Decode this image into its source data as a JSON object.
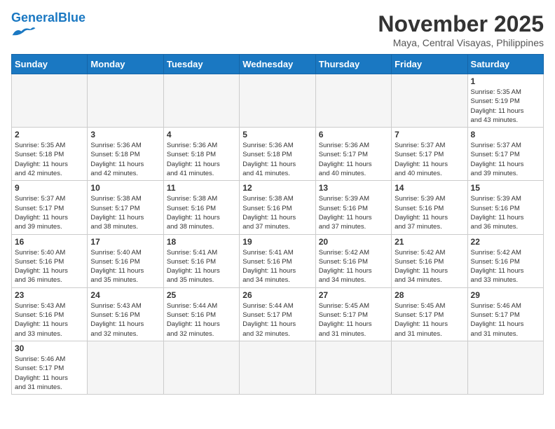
{
  "header": {
    "logo_general": "General",
    "logo_blue": "Blue",
    "month_title": "November 2025",
    "location": "Maya, Central Visayas, Philippines"
  },
  "weekdays": [
    "Sunday",
    "Monday",
    "Tuesday",
    "Wednesday",
    "Thursday",
    "Friday",
    "Saturday"
  ],
  "weeks": [
    [
      {
        "day": "",
        "info": ""
      },
      {
        "day": "",
        "info": ""
      },
      {
        "day": "",
        "info": ""
      },
      {
        "day": "",
        "info": ""
      },
      {
        "day": "",
        "info": ""
      },
      {
        "day": "",
        "info": ""
      },
      {
        "day": "1",
        "info": "Sunrise: 5:35 AM\nSunset: 5:19 PM\nDaylight: 11 hours\nand 43 minutes."
      }
    ],
    [
      {
        "day": "2",
        "info": "Sunrise: 5:35 AM\nSunset: 5:18 PM\nDaylight: 11 hours\nand 42 minutes."
      },
      {
        "day": "3",
        "info": "Sunrise: 5:36 AM\nSunset: 5:18 PM\nDaylight: 11 hours\nand 42 minutes."
      },
      {
        "day": "4",
        "info": "Sunrise: 5:36 AM\nSunset: 5:18 PM\nDaylight: 11 hours\nand 41 minutes."
      },
      {
        "day": "5",
        "info": "Sunrise: 5:36 AM\nSunset: 5:18 PM\nDaylight: 11 hours\nand 41 minutes."
      },
      {
        "day": "6",
        "info": "Sunrise: 5:36 AM\nSunset: 5:17 PM\nDaylight: 11 hours\nand 40 minutes."
      },
      {
        "day": "7",
        "info": "Sunrise: 5:37 AM\nSunset: 5:17 PM\nDaylight: 11 hours\nand 40 minutes."
      },
      {
        "day": "8",
        "info": "Sunrise: 5:37 AM\nSunset: 5:17 PM\nDaylight: 11 hours\nand 39 minutes."
      }
    ],
    [
      {
        "day": "9",
        "info": "Sunrise: 5:37 AM\nSunset: 5:17 PM\nDaylight: 11 hours\nand 39 minutes."
      },
      {
        "day": "10",
        "info": "Sunrise: 5:38 AM\nSunset: 5:17 PM\nDaylight: 11 hours\nand 38 minutes."
      },
      {
        "day": "11",
        "info": "Sunrise: 5:38 AM\nSunset: 5:16 PM\nDaylight: 11 hours\nand 38 minutes."
      },
      {
        "day": "12",
        "info": "Sunrise: 5:38 AM\nSunset: 5:16 PM\nDaylight: 11 hours\nand 37 minutes."
      },
      {
        "day": "13",
        "info": "Sunrise: 5:39 AM\nSunset: 5:16 PM\nDaylight: 11 hours\nand 37 minutes."
      },
      {
        "day": "14",
        "info": "Sunrise: 5:39 AM\nSunset: 5:16 PM\nDaylight: 11 hours\nand 37 minutes."
      },
      {
        "day": "15",
        "info": "Sunrise: 5:39 AM\nSunset: 5:16 PM\nDaylight: 11 hours\nand 36 minutes."
      }
    ],
    [
      {
        "day": "16",
        "info": "Sunrise: 5:40 AM\nSunset: 5:16 PM\nDaylight: 11 hours\nand 36 minutes."
      },
      {
        "day": "17",
        "info": "Sunrise: 5:40 AM\nSunset: 5:16 PM\nDaylight: 11 hours\nand 35 minutes."
      },
      {
        "day": "18",
        "info": "Sunrise: 5:41 AM\nSunset: 5:16 PM\nDaylight: 11 hours\nand 35 minutes."
      },
      {
        "day": "19",
        "info": "Sunrise: 5:41 AM\nSunset: 5:16 PM\nDaylight: 11 hours\nand 34 minutes."
      },
      {
        "day": "20",
        "info": "Sunrise: 5:42 AM\nSunset: 5:16 PM\nDaylight: 11 hours\nand 34 minutes."
      },
      {
        "day": "21",
        "info": "Sunrise: 5:42 AM\nSunset: 5:16 PM\nDaylight: 11 hours\nand 34 minutes."
      },
      {
        "day": "22",
        "info": "Sunrise: 5:42 AM\nSunset: 5:16 PM\nDaylight: 11 hours\nand 33 minutes."
      }
    ],
    [
      {
        "day": "23",
        "info": "Sunrise: 5:43 AM\nSunset: 5:16 PM\nDaylight: 11 hours\nand 33 minutes."
      },
      {
        "day": "24",
        "info": "Sunrise: 5:43 AM\nSunset: 5:16 PM\nDaylight: 11 hours\nand 32 minutes."
      },
      {
        "day": "25",
        "info": "Sunrise: 5:44 AM\nSunset: 5:16 PM\nDaylight: 11 hours\nand 32 minutes."
      },
      {
        "day": "26",
        "info": "Sunrise: 5:44 AM\nSunset: 5:17 PM\nDaylight: 11 hours\nand 32 minutes."
      },
      {
        "day": "27",
        "info": "Sunrise: 5:45 AM\nSunset: 5:17 PM\nDaylight: 11 hours\nand 31 minutes."
      },
      {
        "day": "28",
        "info": "Sunrise: 5:45 AM\nSunset: 5:17 PM\nDaylight: 11 hours\nand 31 minutes."
      },
      {
        "day": "29",
        "info": "Sunrise: 5:46 AM\nSunset: 5:17 PM\nDaylight: 11 hours\nand 31 minutes."
      }
    ],
    [
      {
        "day": "30",
        "info": "Sunrise: 5:46 AM\nSunset: 5:17 PM\nDaylight: 11 hours\nand 31 minutes."
      },
      {
        "day": "",
        "info": ""
      },
      {
        "day": "",
        "info": ""
      },
      {
        "day": "",
        "info": ""
      },
      {
        "day": "",
        "info": ""
      },
      {
        "day": "",
        "info": ""
      },
      {
        "day": "",
        "info": ""
      }
    ]
  ]
}
